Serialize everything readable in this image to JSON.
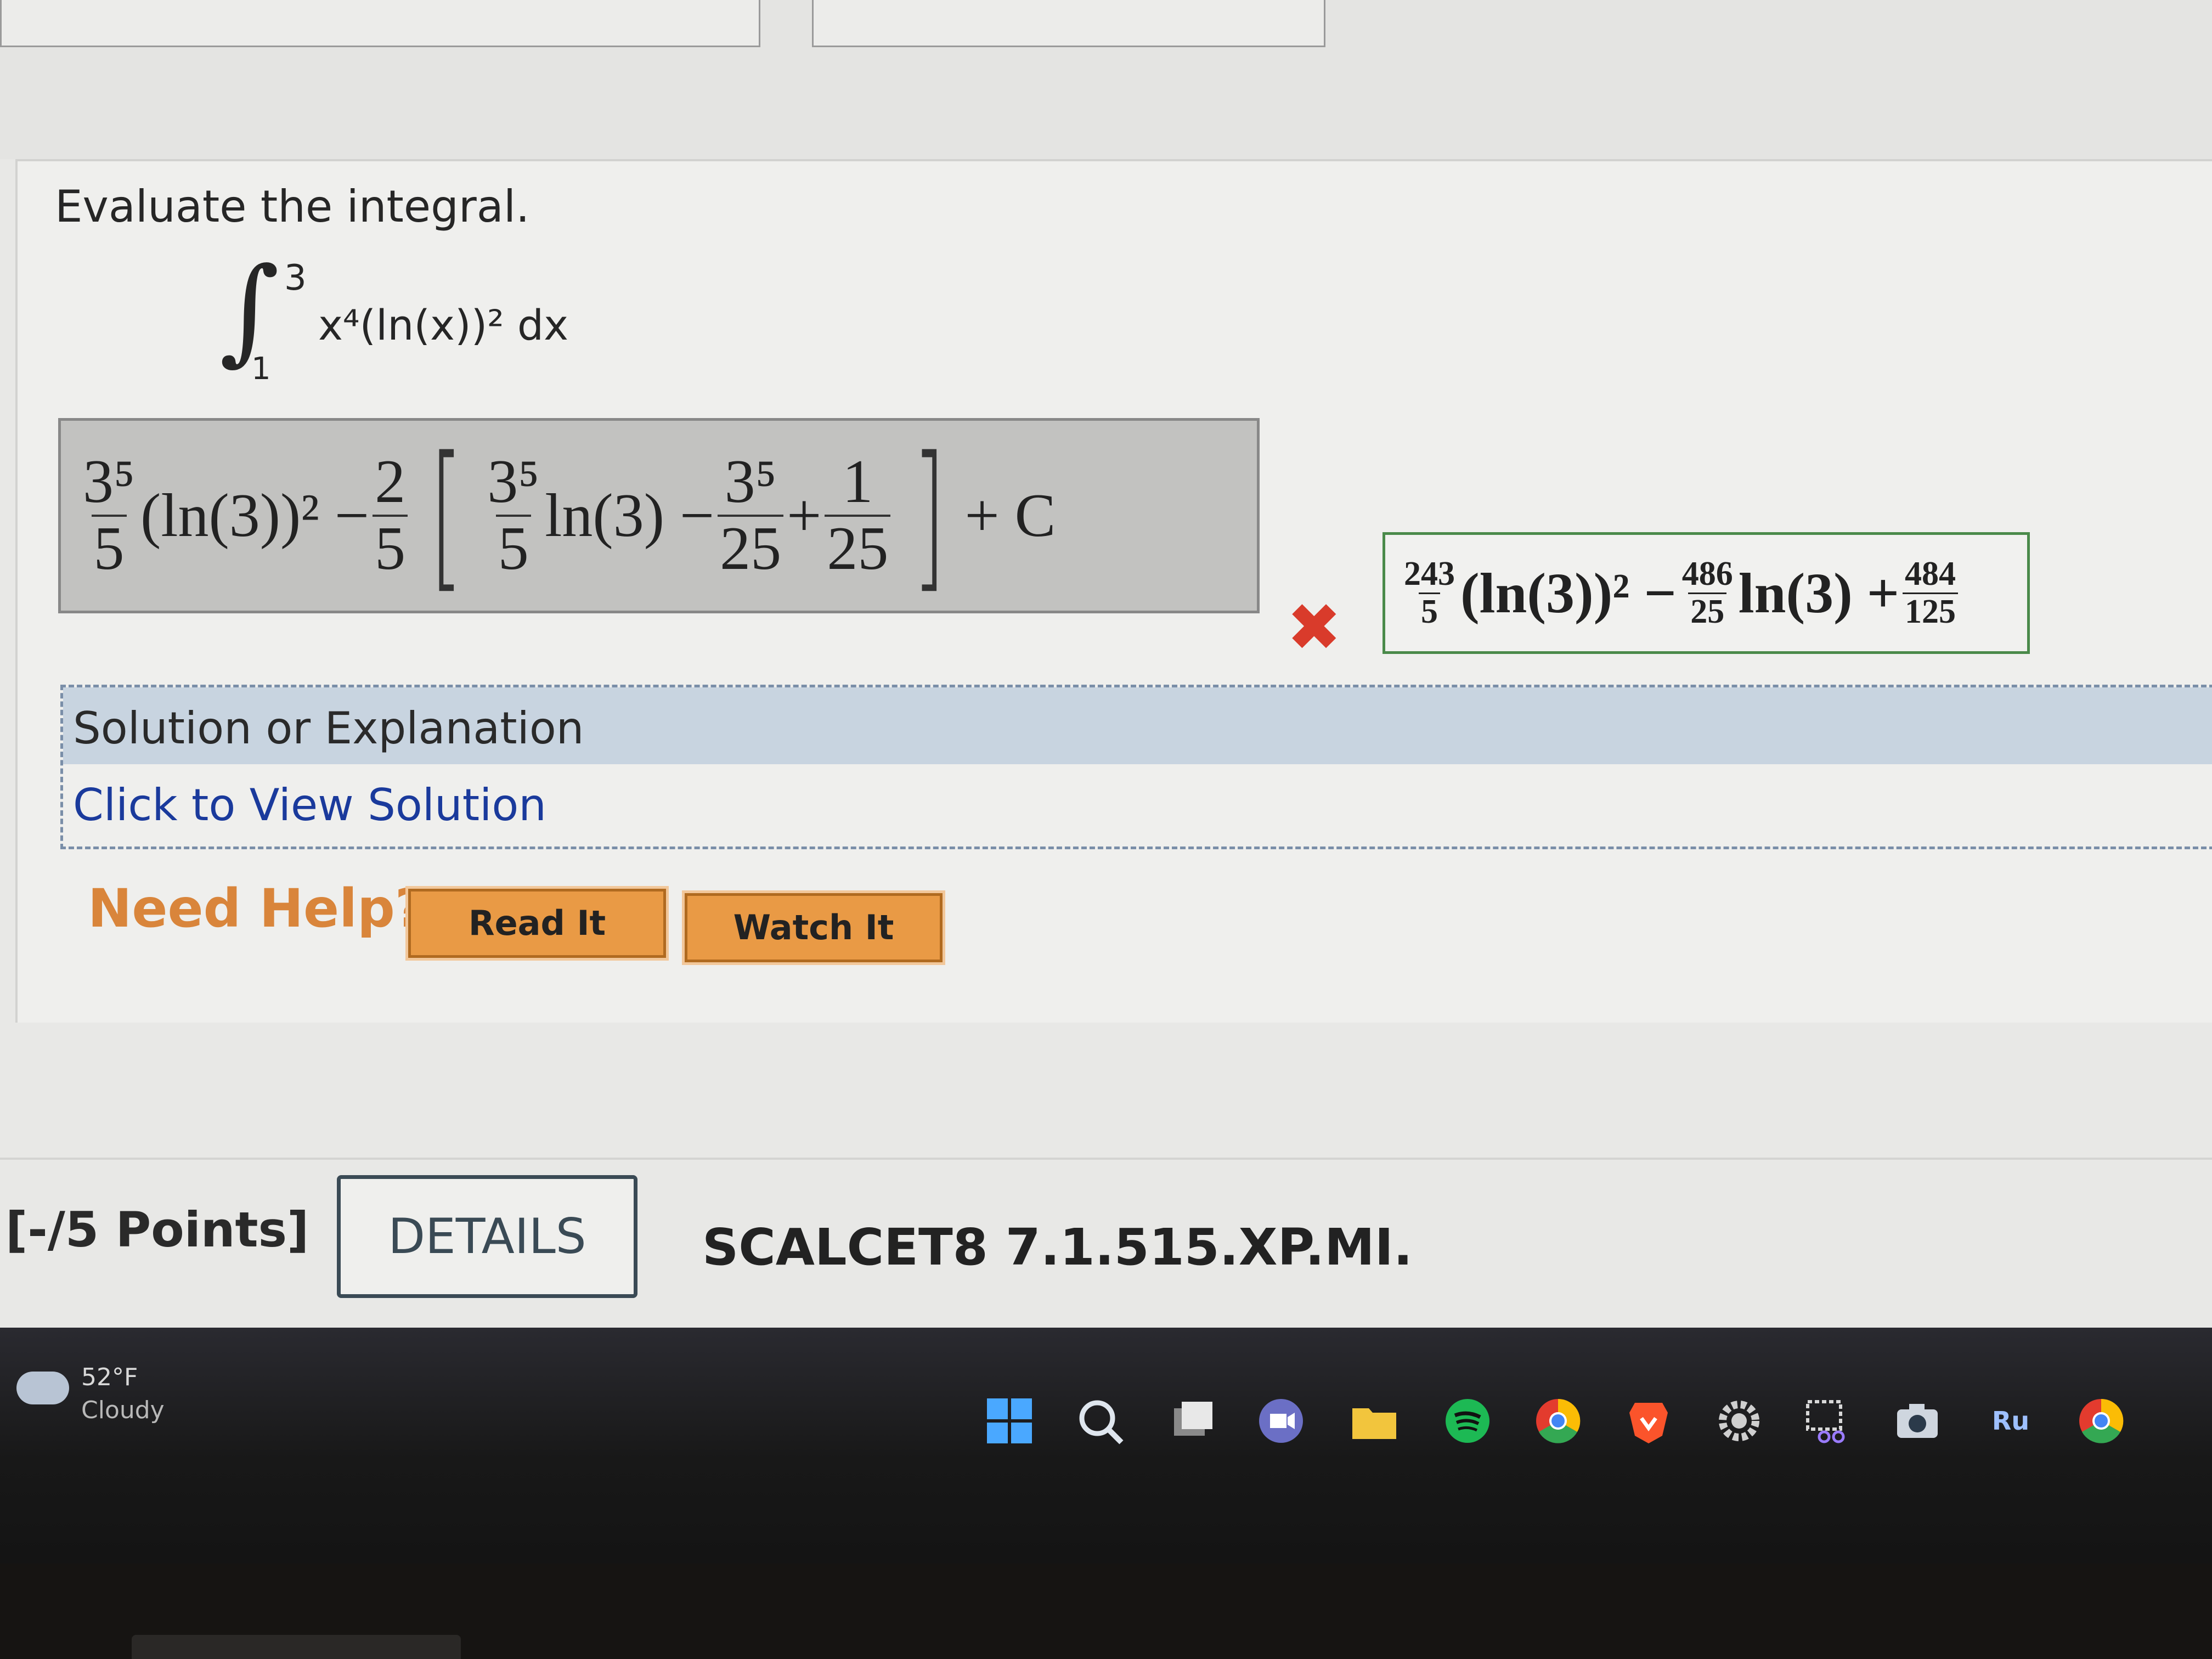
{
  "prompt": "Evaluate the integral.",
  "integral": {
    "upper": "3",
    "lower": "1",
    "integrand": "x⁴(ln(x))² dx"
  },
  "student_answer": {
    "t1_num": "3⁵",
    "t1_den": "5",
    "t1_rest": "(ln(3))² −",
    "t2_num": "2",
    "t2_den": "5",
    "bracket_open": "[",
    "b1_num": "3⁵",
    "b1_den": "5",
    "b1_rest": "ln(3) −",
    "b2_num": "3⁵",
    "b2_den": "25",
    "plus": "+",
    "b3_num": "1",
    "b3_den": "25",
    "bracket_close": "]",
    "tail": "+ C"
  },
  "result_mark": "✖",
  "correct_answer": {
    "c1_num": "243",
    "c1_den": "5",
    "c1_rest": "(ln(3))² −",
    "c2_num": "486",
    "c2_den": "25",
    "c2_rest": "ln(3) +",
    "c3_num": "484",
    "c3_den": "125"
  },
  "solution": {
    "title": "Solution or Explanation",
    "link": "Click to View Solution"
  },
  "help": {
    "label": "Need Help?",
    "read_it": "Read It",
    "watch_it": "Watch It"
  },
  "next_problem": {
    "points": "[-/5 Points]",
    "details": "DETAILS",
    "id": "SCALCET8 7.1.515.XP.MI."
  },
  "taskbar": {
    "temperature": "52°F",
    "condition": "Cloudy",
    "lang": "Ru",
    "icons": [
      "windows-start-icon",
      "search-icon",
      "task-view-icon",
      "teams-icon",
      "file-explorer-icon",
      "spotify-icon",
      "chrome-icon",
      "brave-icon",
      "settings-icon",
      "snipping-tool-icon",
      "camera-icon",
      "chrome-profile-icon"
    ]
  }
}
